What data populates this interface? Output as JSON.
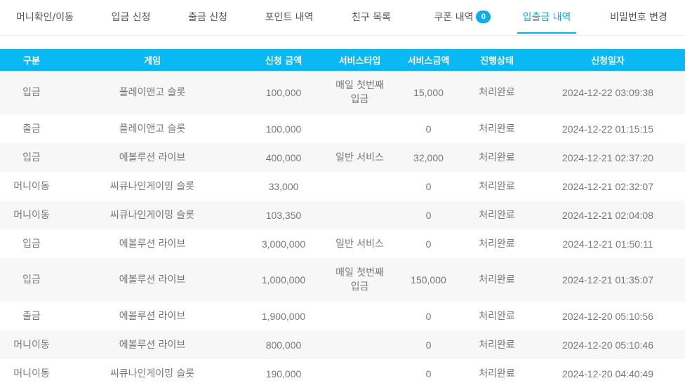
{
  "tabs": [
    {
      "label": "머니확인/이동"
    },
    {
      "label": "입금 신청"
    },
    {
      "label": "출금 신청"
    },
    {
      "label": "포인트 내역"
    },
    {
      "label": "친구 목록"
    },
    {
      "label": "쿠폰 내역",
      "badge": "0"
    },
    {
      "label": "입출금 내역",
      "active": true
    },
    {
      "label": "비밀번호 변경"
    }
  ],
  "colors": {
    "accent": "#0aaeea",
    "header_bg": "#0ab8f4",
    "row_alt": "#f7f7f7"
  },
  "table": {
    "headers": [
      "구분",
      "게임",
      "신청 금액",
      "서비스타입",
      "서비스금액",
      "진행상태",
      "신청일자"
    ],
    "rows": [
      {
        "type": "입금",
        "game": "플레이앤고 슬롯",
        "amount": "100,000",
        "service_type": "매일 첫번째\n입금",
        "service_amount": "15,000",
        "status": "처리완료",
        "date": "2024-12-22 03:09:38"
      },
      {
        "type": "출금",
        "game": "플레이앤고 슬롯",
        "amount": "100,000",
        "service_type": "",
        "service_amount": "0",
        "status": "처리완료",
        "date": "2024-12-22 01:15:15"
      },
      {
        "type": "입금",
        "game": "에볼루션 라이브",
        "amount": "400,000",
        "service_type": "일반 서비스",
        "service_amount": "32,000",
        "status": "처리완료",
        "date": "2024-12-21 02:37:20"
      },
      {
        "type": "머니이동",
        "game": "씨큐나인게이밍 슬롯",
        "amount": "33,000",
        "service_type": "",
        "service_amount": "0",
        "status": "처리완료",
        "date": "2024-12-21 02:32:07"
      },
      {
        "type": "머니이동",
        "game": "씨큐나인게이밍 슬롯",
        "amount": "103,350",
        "service_type": "",
        "service_amount": "0",
        "status": "처리완료",
        "date": "2024-12-21 02:04:08"
      },
      {
        "type": "입금",
        "game": "에볼루션 라이브",
        "amount": "3,000,000",
        "service_type": "일반 서비스",
        "service_amount": "0",
        "status": "처리완료",
        "date": "2024-12-21 01:50:11"
      },
      {
        "type": "입금",
        "game": "에볼루션 라이브",
        "amount": "1,000,000",
        "service_type": "매일 첫번째\n입금",
        "service_amount": "150,000",
        "status": "처리완료",
        "date": "2024-12-21 01:35:07"
      },
      {
        "type": "출금",
        "game": "에볼루션 라이브",
        "amount": "1,900,000",
        "service_type": "",
        "service_amount": "0",
        "status": "처리완료",
        "date": "2024-12-20 05:10:56"
      },
      {
        "type": "머니이동",
        "game": "에볼루션 라이브",
        "amount": "800,000",
        "service_type": "",
        "service_amount": "0",
        "status": "처리완료",
        "date": "2024-12-20 05:10:46"
      },
      {
        "type": "머니이동",
        "game": "씨큐나인게이밍 슬롯",
        "amount": "190,000",
        "service_type": "",
        "service_amount": "0",
        "status": "처리완료",
        "date": "2024-12-20 04:40:49"
      }
    ]
  }
}
